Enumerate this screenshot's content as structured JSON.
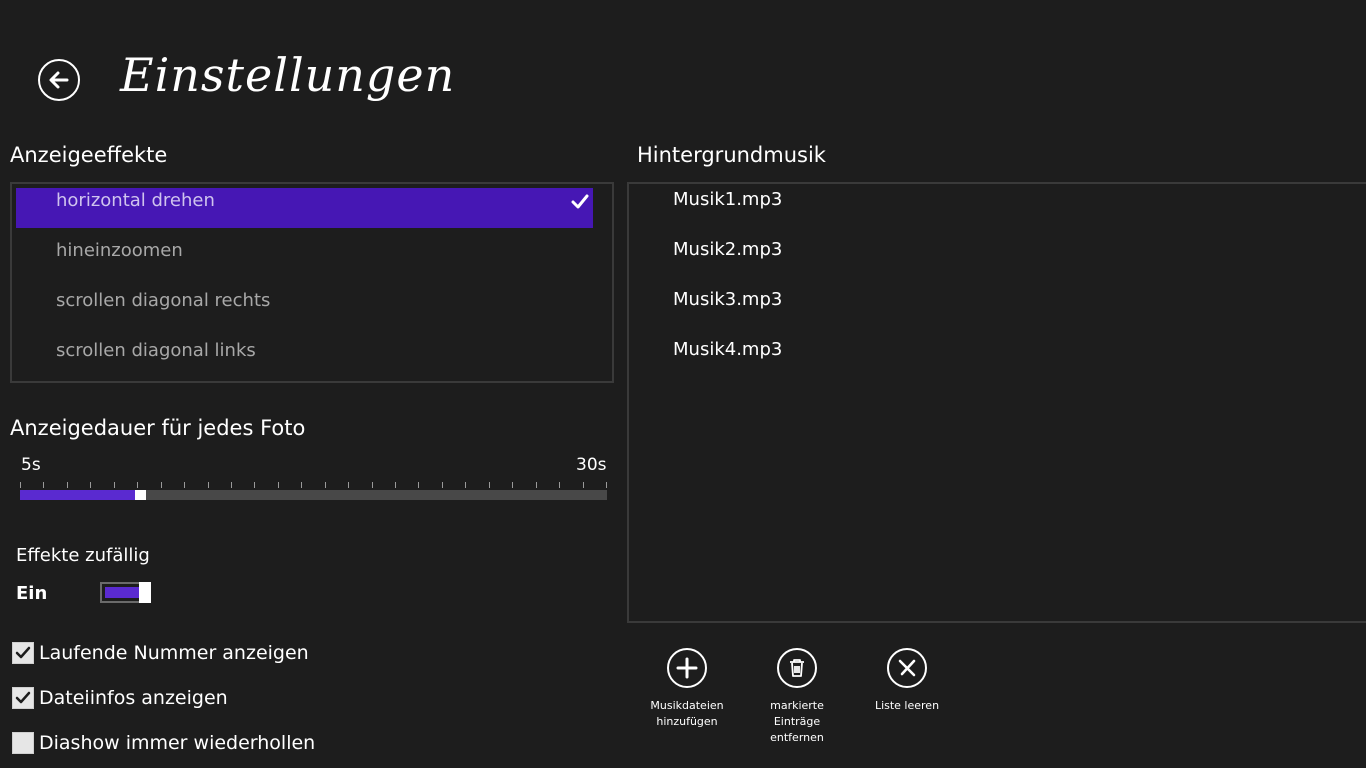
{
  "header": {
    "title": "Einstellungen",
    "back_icon": "back-arrow-icon"
  },
  "effects": {
    "heading": "Anzeigeeffekte",
    "items": [
      {
        "label": "horizontal drehen",
        "selected": true
      },
      {
        "label": "hineinzoomen",
        "selected": false
      },
      {
        "label": "scrollen diagonal rechts",
        "selected": false
      },
      {
        "label": "scrollen diagonal links",
        "selected": false
      }
    ]
  },
  "duration": {
    "heading": "Anzeigedauer für jedes Foto",
    "min_label": "5s",
    "max_label": "30s",
    "min": 5,
    "max": 30,
    "value": 10
  },
  "random_effects": {
    "label": "Effekte zufällig",
    "state_label": "Ein",
    "on": true
  },
  "checkboxes": [
    {
      "label": "Laufende Nummer anzeigen",
      "checked": true
    },
    {
      "label": "Dateiinfos anzeigen",
      "checked": true
    },
    {
      "label": "Diashow immer wiederhollen",
      "checked": false
    }
  ],
  "music": {
    "heading": "Hintergrundmusik",
    "files": [
      "Musik1.mp3",
      "Musik2.mp3",
      "Musik3.mp3",
      "Musik4.mp3"
    ]
  },
  "app_bar": {
    "add": {
      "label": "Musikdateien\nhinzufügen",
      "icon": "plus-icon"
    },
    "remove": {
      "label": "markierte\nEinträge\nentfernen",
      "icon": "trash-icon"
    },
    "clear": {
      "label": "Liste leeren",
      "icon": "clear-x-icon"
    }
  },
  "colors": {
    "background": "#1d1d1d",
    "accent": "#4617b4",
    "accent_light": "#5a2ad0"
  }
}
